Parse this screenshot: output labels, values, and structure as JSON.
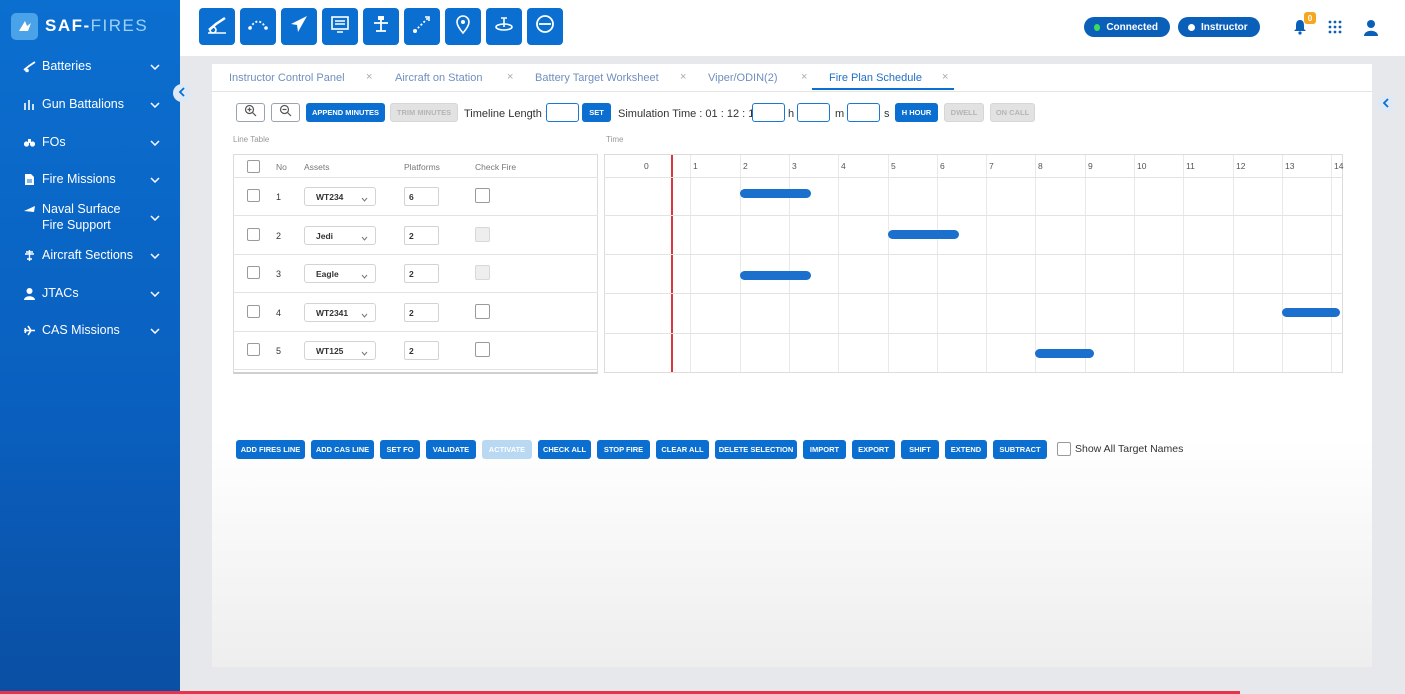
{
  "app": {
    "logo_main": "SAF-",
    "logo_accent": "FIRES"
  },
  "sidebar": {
    "items": [
      {
        "label": "Batteries",
        "icon": "howitzer-icon"
      },
      {
        "label": "Gun Battalions",
        "icon": "gun-battalion-icon"
      },
      {
        "label": "FOs",
        "icon": "binoculars-icon"
      },
      {
        "label": "Fire Missions",
        "icon": "document-icon"
      },
      {
        "label": "Naval Surface Fire Support",
        "icon": "ship-icon"
      },
      {
        "label": "Aircraft Sections",
        "icon": "aircraft-icon"
      },
      {
        "label": "JTACs",
        "icon": "person-icon"
      },
      {
        "label": "CAS Missions",
        "icon": "jet-icon"
      }
    ]
  },
  "topbar": {
    "tools": [
      "artillery-icon",
      "trajectory-icon",
      "jet-icon",
      "screen-icon",
      "tower-icon",
      "target-path-icon",
      "map-pin-icon",
      "radar-dish-icon",
      "no-fly-icon"
    ],
    "connected_label": "Connected",
    "connected_color": "#3ddc5a",
    "role_label": "Instructor",
    "notification_count": "0"
  },
  "tabs": [
    {
      "label": "Instructor Control Panel",
      "active": false
    },
    {
      "label": "Aircraft on Station",
      "active": false
    },
    {
      "label": "Battery Target Worksheet",
      "active": false
    },
    {
      "label": "Viper/ODIN(2)",
      "active": false
    },
    {
      "label": "Fire Plan Schedule",
      "active": true
    }
  ],
  "toolbar": {
    "append_minutes": "APPEND MINUTES",
    "trim_minutes": "TRIM MINUTES",
    "timeline_length_label": "Timeline Length :",
    "set_label": "SET",
    "simulation_time_label": "Simulation Time : 01 : 12 : 12",
    "h_unit": "h",
    "m_unit": "m",
    "s_unit": "s",
    "h_hour": "H HOUR",
    "dwell": "DWELL",
    "on_call": "ON CALL"
  },
  "line_table": {
    "label": "Line Table",
    "headers": {
      "no": "No",
      "assets": "Assets",
      "platforms": "Platforms",
      "check_fire": "Check Fire"
    },
    "rows": [
      {
        "no": "1",
        "asset": "WT234",
        "platforms": "6",
        "check_fire_enabled": true
      },
      {
        "no": "2",
        "asset": "Jedi",
        "platforms": "2",
        "check_fire_enabled": false
      },
      {
        "no": "3",
        "asset": "Eagle",
        "platforms": "2",
        "check_fire_enabled": false
      },
      {
        "no": "4",
        "asset": "WT2341",
        "platforms": "2",
        "check_fire_enabled": true
      },
      {
        "no": "5",
        "asset": "WT125",
        "platforms": "2",
        "check_fire_enabled": true
      }
    ]
  },
  "timeline": {
    "label": "Time",
    "ticks": [
      "0",
      "1",
      "2",
      "3",
      "4",
      "5",
      "6",
      "7",
      "8",
      "9",
      "10",
      "11",
      "12",
      "13",
      "14"
    ],
    "current_time": 0.6,
    "bars": [
      {
        "row": 1,
        "start": 2.0,
        "end": 3.45
      },
      {
        "row": 2,
        "start": 5.0,
        "end": 6.45
      },
      {
        "row": 3,
        "start": 2.0,
        "end": 3.45
      },
      {
        "row": 4,
        "start": 13.0,
        "end": 14.2
      },
      {
        "row": 5,
        "start": 8.0,
        "end": 9.2
      }
    ]
  },
  "actions": {
    "add_fires_line": "ADD FIRES LINE",
    "add_cas_line": "ADD CAS LINE",
    "set_fo": "SET FO",
    "validate": "VALIDATE",
    "activate": "ACTIVATE",
    "check_all": "CHECK ALL",
    "stop_fire": "STOP FIRE",
    "clear_all": "CLEAR ALL",
    "delete_selection": "DELETE SELECTION",
    "import": "IMPORT",
    "export": "EXPORT",
    "shift": "SHIFT",
    "extend": "EXTEND",
    "subtract": "SUBTRACT",
    "show_all_target_names": "Show All Target Names"
  }
}
